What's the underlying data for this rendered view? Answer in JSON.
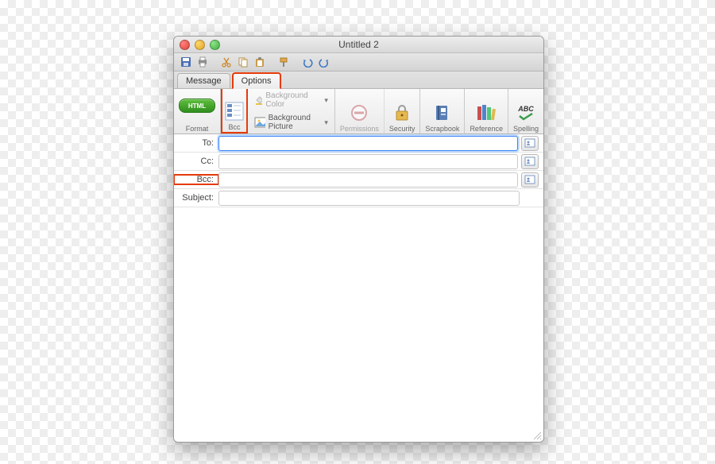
{
  "window": {
    "title": "Untitled 2"
  },
  "quickToolbar": {
    "save": "save-icon",
    "print": "print-icon",
    "cut": "cut-icon",
    "copy": "copy-icon",
    "paste": "paste-icon",
    "undo": "undo-icon",
    "redo": "redo-icon"
  },
  "tabs": {
    "message": "Message",
    "options": "Options"
  },
  "ribbon": {
    "format": {
      "pill": "HTML",
      "label": "Format"
    },
    "bcc": {
      "label": "Bcc"
    },
    "background": {
      "colorLabel": "Background Color",
      "pictureLabel": "Background Picture"
    },
    "permissions": {
      "label": "Permissions"
    },
    "security": {
      "label": "Security"
    },
    "scrapbook": {
      "label": "Scrapbook"
    },
    "reference": {
      "label": "Reference"
    },
    "spelling": {
      "label": "Spelling",
      "abc": "ABC"
    }
  },
  "fields": {
    "to": "To:",
    "cc": "Cc:",
    "bcc": "Bcc:",
    "subject": "Subject:"
  }
}
